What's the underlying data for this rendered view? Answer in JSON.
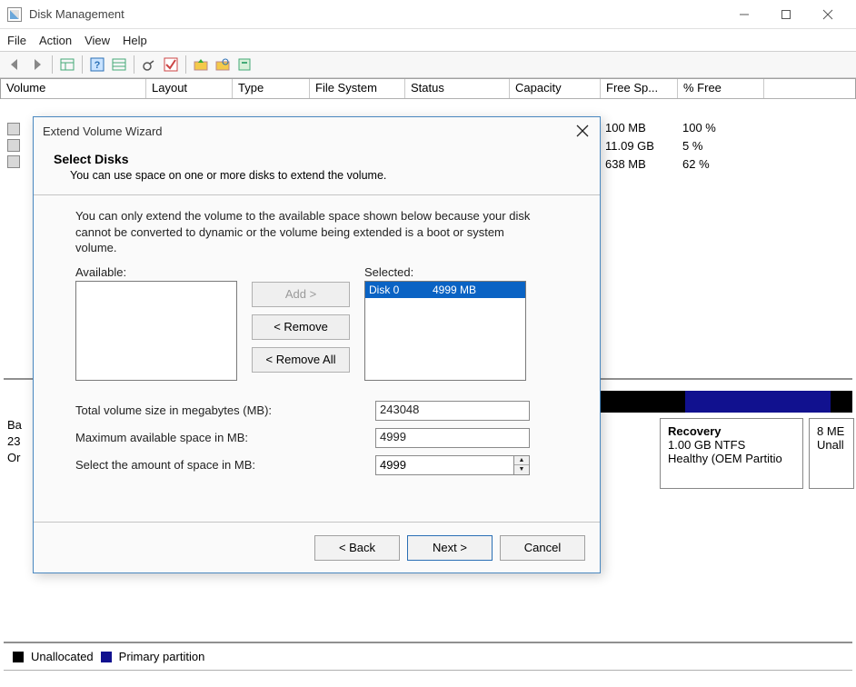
{
  "window": {
    "title": "Disk Management"
  },
  "menu": {
    "file": "File",
    "action": "Action",
    "view": "View",
    "help": "Help"
  },
  "table": {
    "headers": {
      "volume": "Volume",
      "layout": "Layout",
      "type": "Type",
      "fs": "File System",
      "status": "Status",
      "capacity": "Capacity",
      "free": "Free Sp...",
      "pct": "% Free"
    },
    "rows": [
      {
        "free": "100 MB",
        "pct": "100 %"
      },
      {
        "free": "11.09 GB",
        "pct": "5 %"
      },
      {
        "free": "638 MB",
        "pct": "62 %"
      }
    ]
  },
  "disk_info": {
    "line1": "Ba",
    "line2": "23",
    "line3": "Or"
  },
  "partitions": {
    "recovery": {
      "title": "Recovery",
      "size": "1.00 GB NTFS",
      "status": "Healthy (OEM Partitio"
    },
    "unalloc": {
      "size": "8 ME",
      "status": "Unall"
    }
  },
  "legend": {
    "unallocated": "Unallocated",
    "primary": "Primary partition"
  },
  "wizard": {
    "title": "Extend Volume Wizard",
    "heading": "Select Disks",
    "subheading": "You can use space on one or more disks to extend the volume.",
    "note": "You can only extend the volume to the available space shown below because your disk cannot be converted to dynamic or the volume being extended is a boot or system volume.",
    "available_label": "Available:",
    "selected_label": "Selected:",
    "selected_item": {
      "disk": "Disk 0",
      "size": "4999 MB"
    },
    "btn_add": "Add >",
    "btn_remove": "< Remove",
    "btn_remove_all": "< Remove All",
    "field_total_label": "Total volume size in megabytes (MB):",
    "field_total_value": "243048",
    "field_max_label": "Maximum available space in MB:",
    "field_max_value": "4999",
    "field_amount_label": "Select the amount of space in MB:",
    "field_amount_value": "4999",
    "btn_back": "< Back",
    "btn_next": "Next >",
    "btn_cancel": "Cancel"
  }
}
